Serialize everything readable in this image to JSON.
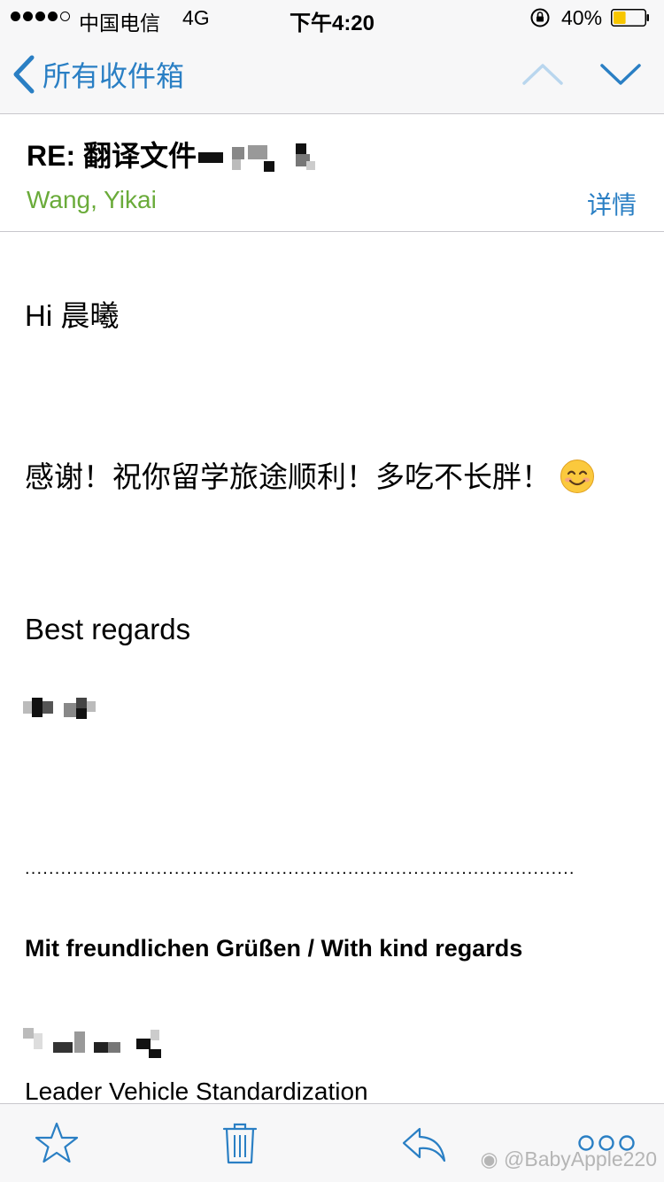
{
  "status_bar": {
    "carrier": "中国电信",
    "network": "4G",
    "time": "下午4:20",
    "battery_percent": "40%",
    "battery_level": 0.4,
    "battery_color": "#f7c600"
  },
  "nav": {
    "back_label": "所有收件箱",
    "accent_color": "#2a7fc4",
    "icons": {
      "back": "chevron-left-icon",
      "up": "chevron-up-icon",
      "down": "chevron-down-icon"
    }
  },
  "header": {
    "subject": "RE: 翻译文件",
    "sender": "Wang, Yikai",
    "details_label": "详情",
    "sender_color": "#6aab3a"
  },
  "body": {
    "greeting": "Hi 晨曦",
    "thanks": "感谢！祝你留学旅途顺利！多吃不长胖！",
    "emoji": "smiling-face-icon",
    "closing": "Best regards",
    "separator": "............................................................................................",
    "kind_regards": "Mit freundlichen Grüßen / With kind regards",
    "role": "Leader Vehicle Standardization"
  },
  "toolbar": {
    "icons": [
      "star-icon",
      "trash-icon",
      "reply-icon",
      "more-icon"
    ]
  },
  "watermark": "@BabyApple220"
}
